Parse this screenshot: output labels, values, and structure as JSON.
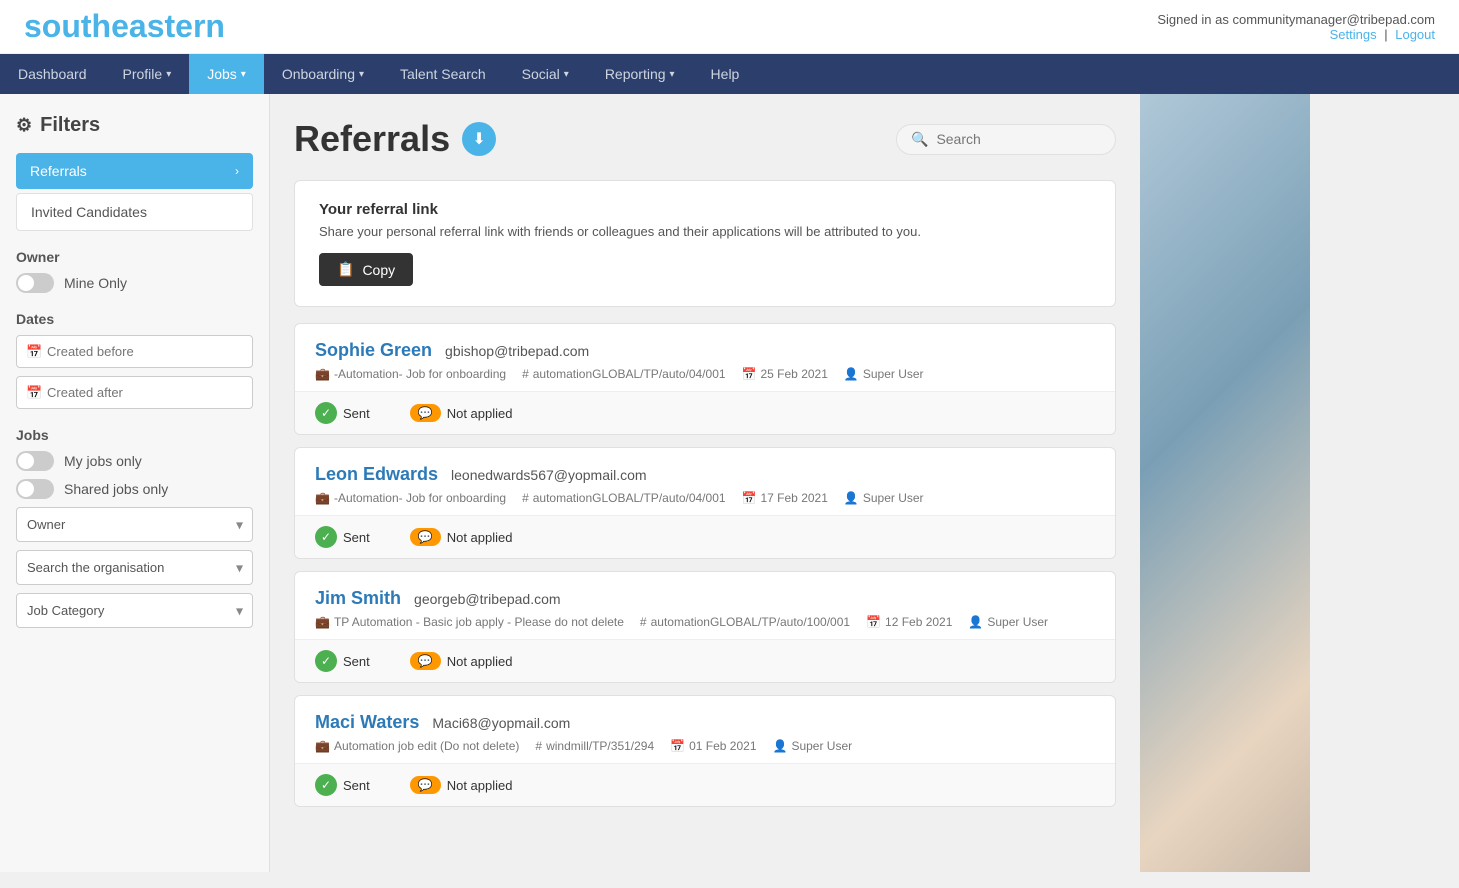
{
  "brand": {
    "name_part1": "south",
    "name_part2": "eastern"
  },
  "topbar": {
    "signed_in_text": "Signed in as communitymanager@tribepad.com",
    "settings_label": "Settings",
    "separator": "|",
    "logout_label": "Logout"
  },
  "nav": {
    "items": [
      {
        "label": "Dashboard",
        "active": false,
        "dropdown": false
      },
      {
        "label": "Profile",
        "active": false,
        "dropdown": true
      },
      {
        "label": "Jobs",
        "active": true,
        "dropdown": true
      },
      {
        "label": "Onboarding",
        "active": false,
        "dropdown": true
      },
      {
        "label": "Talent Search",
        "active": false,
        "dropdown": false
      },
      {
        "label": "Social",
        "active": false,
        "dropdown": true
      },
      {
        "label": "Reporting",
        "active": false,
        "dropdown": true
      },
      {
        "label": "Help",
        "active": false,
        "dropdown": false
      }
    ]
  },
  "sidebar": {
    "title": "Filters",
    "nav_items": [
      {
        "label": "Referrals",
        "active": true
      },
      {
        "label": "Invited Candidates",
        "active": false
      }
    ],
    "owner_section": "Owner",
    "mine_only_label": "Mine Only",
    "dates_section": "Dates",
    "created_before_placeholder": "Created before",
    "created_after_placeholder": "Created after",
    "jobs_section": "Jobs",
    "my_jobs_only_label": "My jobs only",
    "shared_jobs_only_label": "Shared jobs only",
    "owner_dropdown": "Owner",
    "search_org_placeholder": "Search the organisation",
    "job_category_placeholder": "Job Category"
  },
  "main": {
    "page_title": "Referrals",
    "search_placeholder": "Search",
    "referral_box": {
      "heading": "Your referral link",
      "description": "Share your personal referral link with friends or colleagues and their applications will be attributed to you.",
      "copy_button": "Copy"
    },
    "candidates": [
      {
        "name": "Sophie Green",
        "email": "gbishop@tribepad.com",
        "job": "-Automation- Job for onboarding",
        "ref": "automationGLOBAL/TP/auto/04/001",
        "date": "25 Feb 2021",
        "user": "Super User",
        "status_left": "Sent",
        "status_right": "Not applied"
      },
      {
        "name": "Leon Edwards",
        "email": "leonedwards567@yopmail.com",
        "job": "-Automation- Job for onboarding",
        "ref": "automationGLOBAL/TP/auto/04/001",
        "date": "17 Feb 2021",
        "user": "Super User",
        "status_left": "Sent",
        "status_right": "Not applied"
      },
      {
        "name": "Jim Smith",
        "email": "georgeb@tribepad.com",
        "job": "TP Automation - Basic job apply - Please do not delete",
        "ref": "automationGLOBAL/TP/auto/100/001",
        "date": "12 Feb 2021",
        "user": "Super User",
        "status_left": "Sent",
        "status_right": "Not applied"
      },
      {
        "name": "Maci Waters",
        "email": "Maci68@yopmail.com",
        "job": "Automation job edit (Do not delete)",
        "ref": "windmill/TP/351/294",
        "date": "01 Feb 2021",
        "user": "Super User",
        "status_left": "Sent",
        "status_right": "Not applied"
      }
    ]
  }
}
